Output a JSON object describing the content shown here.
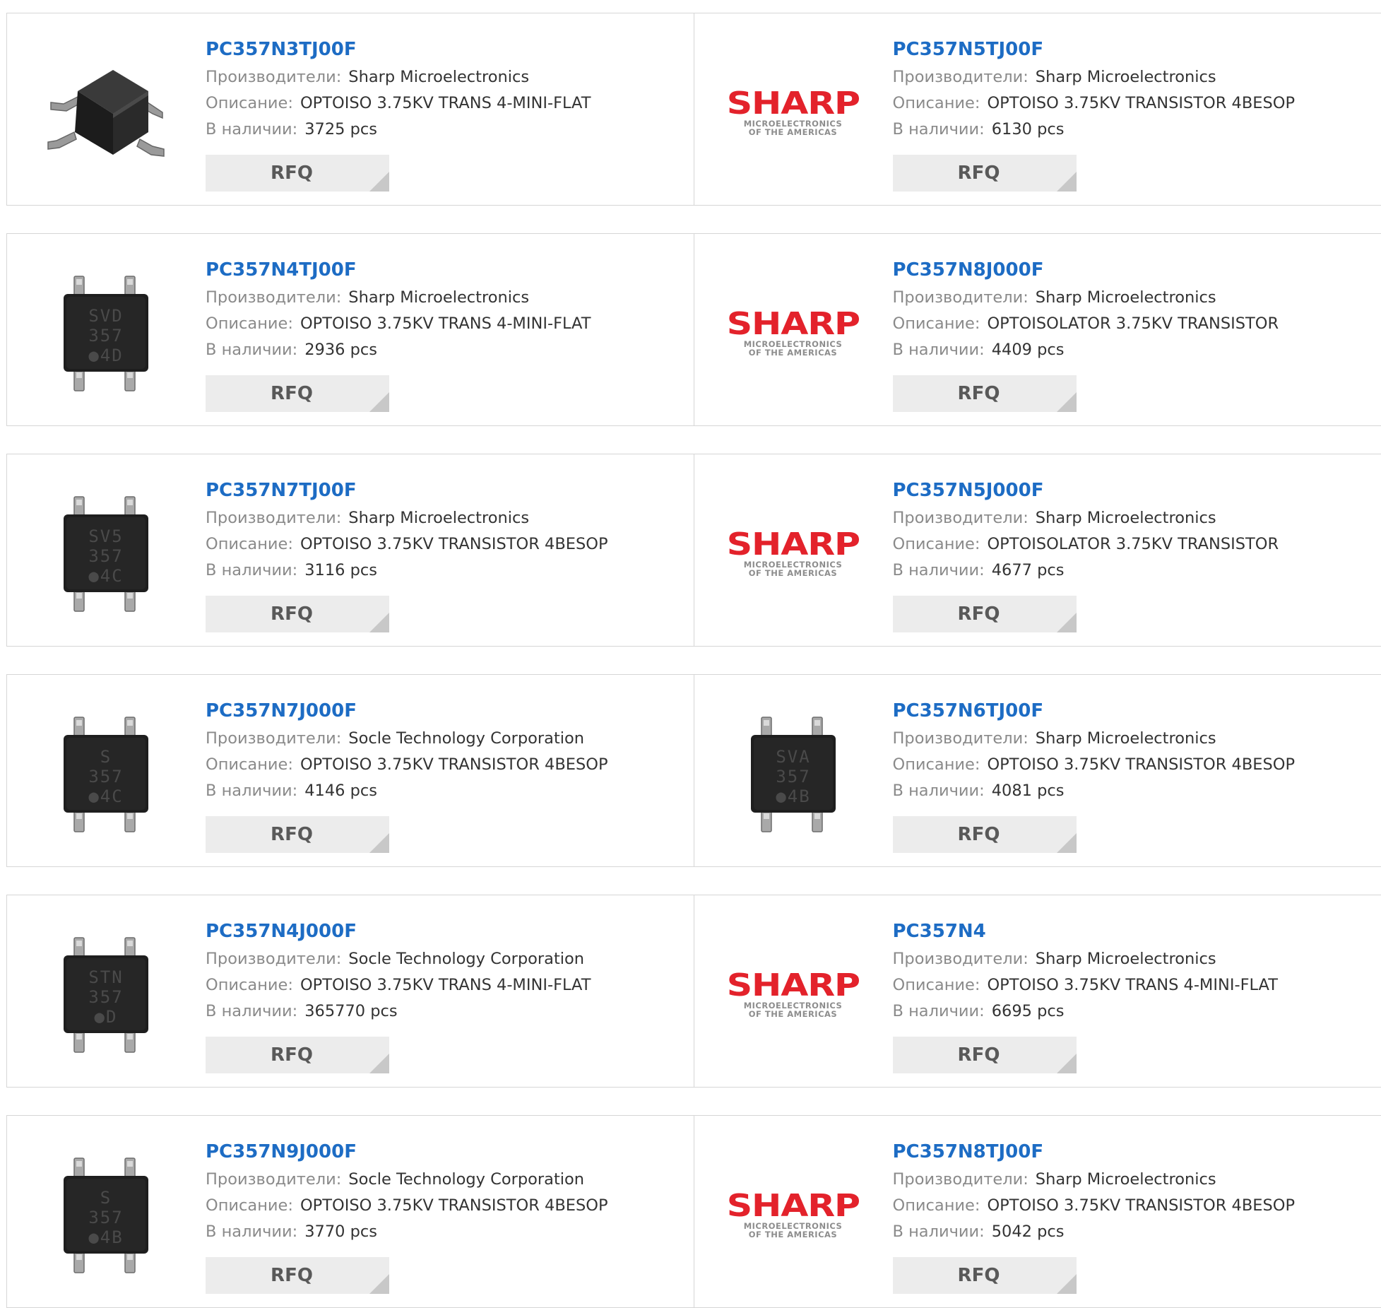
{
  "labels": {
    "manufacturer": "Производители:",
    "description": "Описание:",
    "stock": "В наличии:",
    "rfq": "RFQ"
  },
  "logo": {
    "word": "SHARP",
    "sub1": "MICROELECTRONICS",
    "sub2": "OF THE AMERICAS"
  },
  "colors": {
    "title": "#1d6cc4",
    "logo": "#e3222b",
    "rfq_bg": "#ececec"
  },
  "products": [
    {
      "part": "PC357N3TJ00F",
      "manufacturer": "Sharp Microelectronics",
      "description": "OPTOISO 3.75KV TRANS 4-MINI-FLAT",
      "stock": "3725 pcs",
      "image": "chip-angled-icon"
    },
    {
      "part": "PC357N5TJ00F",
      "manufacturer": "Sharp Microelectronics",
      "description": "OPTOISO 3.75KV TRANSISTOR 4BESOP",
      "stock": "6130 pcs",
      "image": "sharp-logo"
    },
    {
      "part": "PC357N4TJ00F",
      "manufacturer": "Sharp Microelectronics",
      "description": "OPTOISO 3.75KV TRANS 4-MINI-FLAT",
      "stock": "2936 pcs",
      "image": "chip-top-icon",
      "marking": [
        "SVD",
        "357",
        "●4D"
      ]
    },
    {
      "part": "PC357N8J000F",
      "manufacturer": "Sharp Microelectronics",
      "description": "OPTOISOLATOR 3.75KV TRANSISTOR",
      "stock": "4409 pcs",
      "image": "sharp-logo"
    },
    {
      "part": "PC357N7TJ00F",
      "manufacturer": "Sharp Microelectronics",
      "description": "OPTOISO 3.75KV TRANSISTOR 4BESOP",
      "stock": "3116 pcs",
      "image": "chip-top-icon",
      "marking": [
        "SV5",
        "357",
        "●4C"
      ]
    },
    {
      "part": "PC357N5J000F",
      "manufacturer": "Sharp Microelectronics",
      "description": "OPTOISOLATOR 3.75KV TRANSISTOR",
      "stock": "4677 pcs",
      "image": "sharp-logo"
    },
    {
      "part": "PC357N7J000F",
      "manufacturer": "Socle Technology Corporation",
      "description": "OPTOISO 3.75KV TRANSISTOR 4BESOP",
      "stock": "4146 pcs",
      "image": "chip-top-icon",
      "marking": [
        "S",
        "357",
        "●4C"
      ]
    },
    {
      "part": "PC357N6TJ00F",
      "manufacturer": "Sharp Microelectronics",
      "description": "OPTOISO 3.75KV TRANSISTOR 4BESOP",
      "stock": "4081 pcs",
      "image": "chip-top-icon",
      "marking": [
        "SVA",
        "357",
        "●4B"
      ]
    },
    {
      "part": "PC357N4J000F",
      "manufacturer": "Socle Technology Corporation",
      "description": "OPTOISO 3.75KV TRANS 4-MINI-FLAT",
      "stock": "365770 pcs",
      "image": "chip-top-icon",
      "marking": [
        "STN",
        "357",
        "●D"
      ]
    },
    {
      "part": "PC357N4",
      "manufacturer": "Sharp Microelectronics",
      "description": "OPTOISO 3.75KV TRANS 4-MINI-FLAT",
      "stock": "6695 pcs",
      "image": "sharp-logo"
    },
    {
      "part": "PC357N9J000F",
      "manufacturer": "Socle Technology Corporation",
      "description": "OPTOISO 3.75KV TRANSISTOR 4BESOP",
      "stock": "3770 pcs",
      "image": "chip-top-icon",
      "marking": [
        "S",
        "357",
        "●4B"
      ]
    },
    {
      "part": "PC357N8TJ00F",
      "manufacturer": "Sharp Microelectronics",
      "description": "OPTOISO 3.75KV TRANSISTOR 4BESOP",
      "stock": "5042 pcs",
      "image": "sharp-logo"
    }
  ]
}
